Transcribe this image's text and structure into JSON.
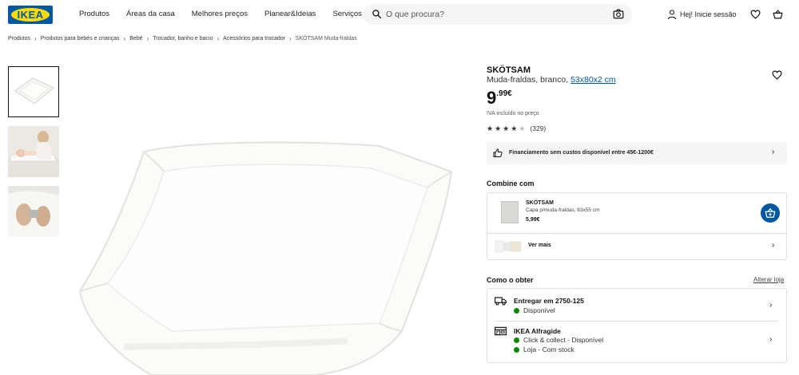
{
  "header": {
    "logo": "IKEA",
    "nav": [
      "Produtos",
      "Áreas da casa",
      "Melhores preços",
      "Planear&Ideias",
      "Serviços"
    ],
    "search_placeholder": "O que procura?",
    "login": "Hej! Inicie sessão"
  },
  "breadcrumb": [
    "Produtos",
    "Produtos para bebés e crianças",
    "Bebé",
    "Trocador, banho e bacio",
    "Acessórios para trocador",
    "SKÖTSAM Muda-fraldas"
  ],
  "product": {
    "name": "SKÖTSAM",
    "description": "Muda-fraldas, branco,",
    "size_link": "53x80x2 cm",
    "price_int": "9",
    "price_dec": ".99€",
    "vat_note": "IVA incluído no preço",
    "rating_value": 4,
    "rating_max": 5,
    "review_count": "(329)"
  },
  "financing": {
    "text": "Financiamento sem custos disponível entre 45€-1200€"
  },
  "combine": {
    "heading": "Combine com",
    "item": {
      "name": "SKÖTSAM",
      "desc": "Capa p/muda-fraldas, 83x55 cm",
      "price": "5,99€"
    },
    "see_more": "Ver mais"
  },
  "availability": {
    "heading": "Como o obter",
    "change_store": "Alterar loja",
    "delivery_title": "Entregar em 2750-125",
    "delivery_status": "Disponível",
    "store_title": "IKEA Alfragide",
    "store_cc": "Click & collect - Disponível",
    "store_stock": "Loja - Com stock",
    "status_color": "#0a8a00"
  },
  "colors": {
    "brand_blue": "#0058a3",
    "brand_yellow": "#ffdb00"
  }
}
